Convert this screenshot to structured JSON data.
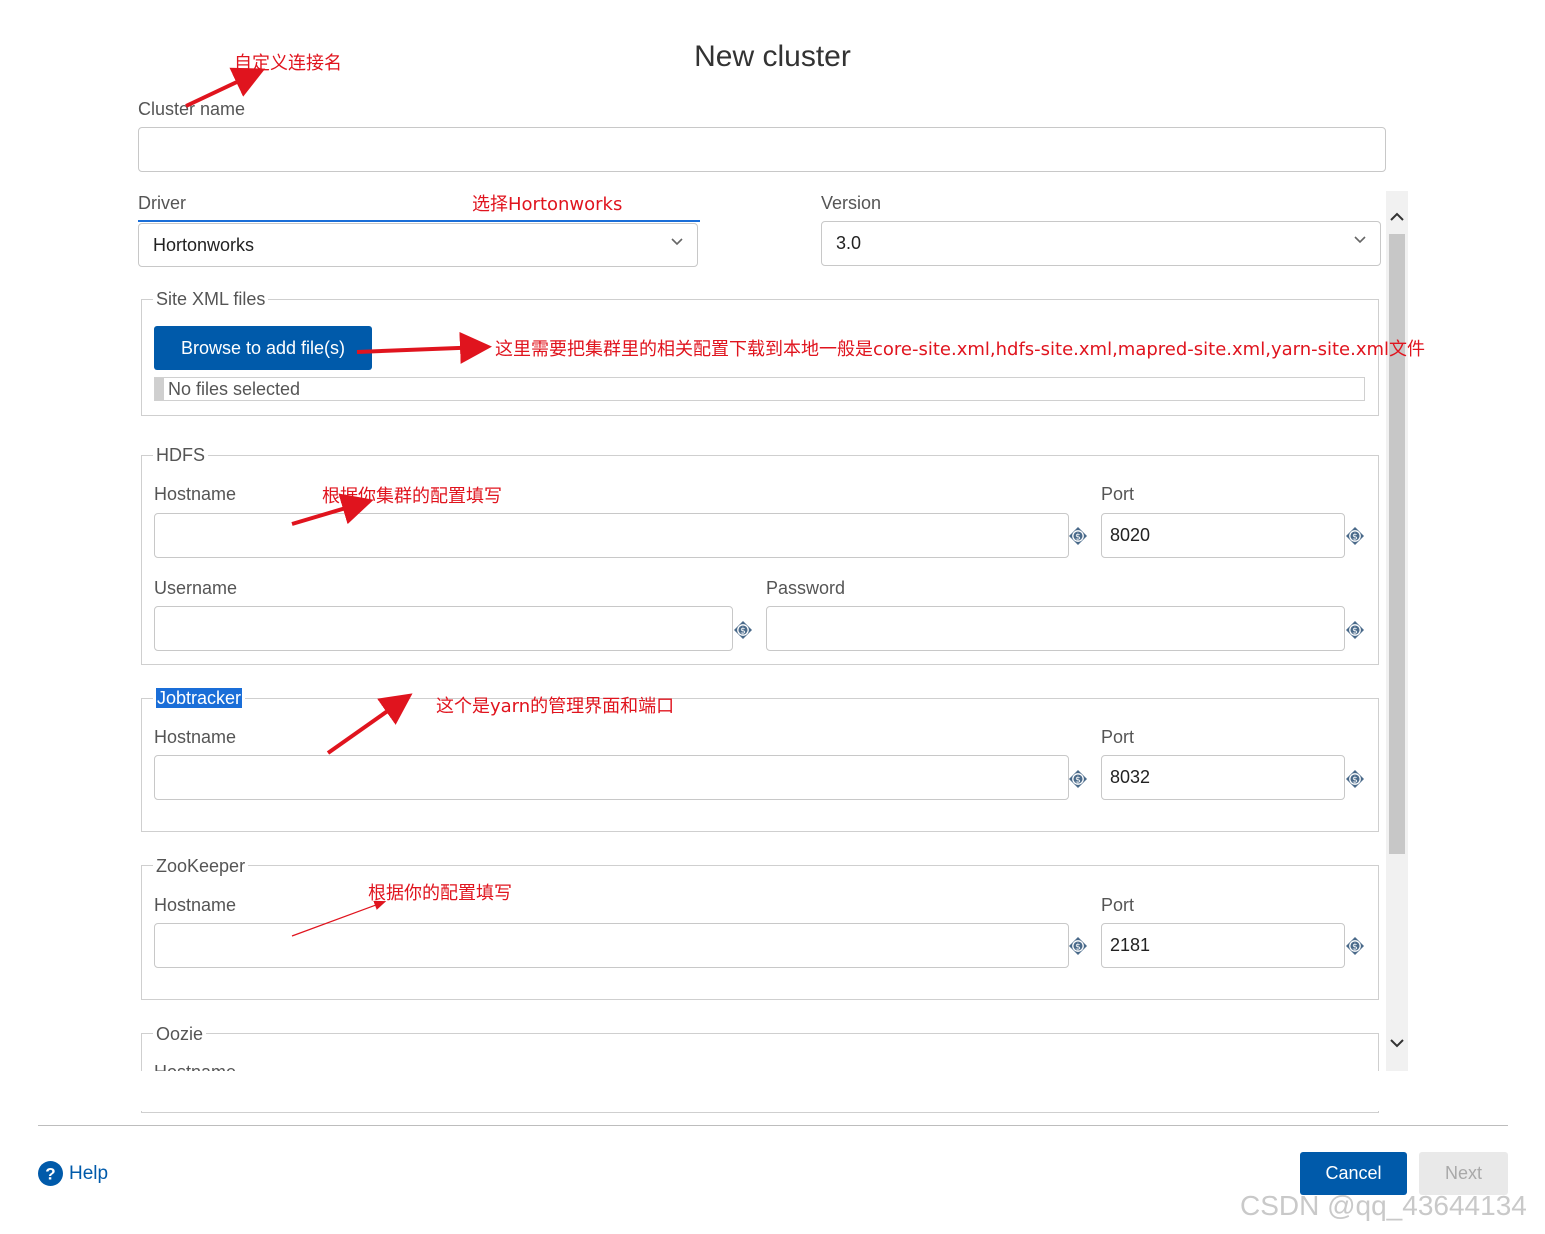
{
  "dialog": {
    "title": "New cluster"
  },
  "cluster_name": {
    "label": "Cluster name",
    "value": ""
  },
  "driver": {
    "label": "Driver",
    "value": "Hortonworks"
  },
  "version": {
    "label": "Version",
    "value": "3.0"
  },
  "site_xml": {
    "legend": "Site XML files",
    "browse_label": "Browse to add file(s)",
    "status": "No files selected"
  },
  "hdfs": {
    "legend": "HDFS",
    "hostname_label": "Hostname",
    "hostname_value": "",
    "port_label": "Port",
    "port_value": "8020",
    "username_label": "Username",
    "username_value": "",
    "password_label": "Password",
    "password_value": ""
  },
  "jobtracker": {
    "legend": "Jobtracker",
    "hostname_label": "Hostname",
    "hostname_value": "",
    "port_label": "Port",
    "port_value": "8032"
  },
  "zookeeper": {
    "legend": "ZooKeeper",
    "hostname_label": "Hostname",
    "hostname_value": "",
    "port_label": "Port",
    "port_value": "2181"
  },
  "oozie": {
    "legend": "Oozie",
    "hostname_label": "Hostname"
  },
  "annotations": {
    "a1": "自定义连接名",
    "a2": "选择Hortonworks",
    "a3": "这里需要把集群里的相关配置下载到本地一般是core-site.xml,hdfs-site.xml,mapred-site.xml,yarn-site.xml文件",
    "a4": "根据你集群的配置填写",
    "a5": "这个是yarn的管理界面和端口",
    "a6": "根据你的配置填写"
  },
  "footer": {
    "help": "Help",
    "cancel": "Cancel",
    "next": "Next"
  },
  "watermark": "CSDN @qq_43644134",
  "colors": {
    "accent": "#005aaa",
    "annotation": "#e0141e",
    "variable_icon": "#4a6a8a"
  },
  "icons": [
    "variable-icon",
    "help-icon",
    "chevron-down-icon",
    "scroll-up-icon",
    "scroll-down-icon"
  ]
}
